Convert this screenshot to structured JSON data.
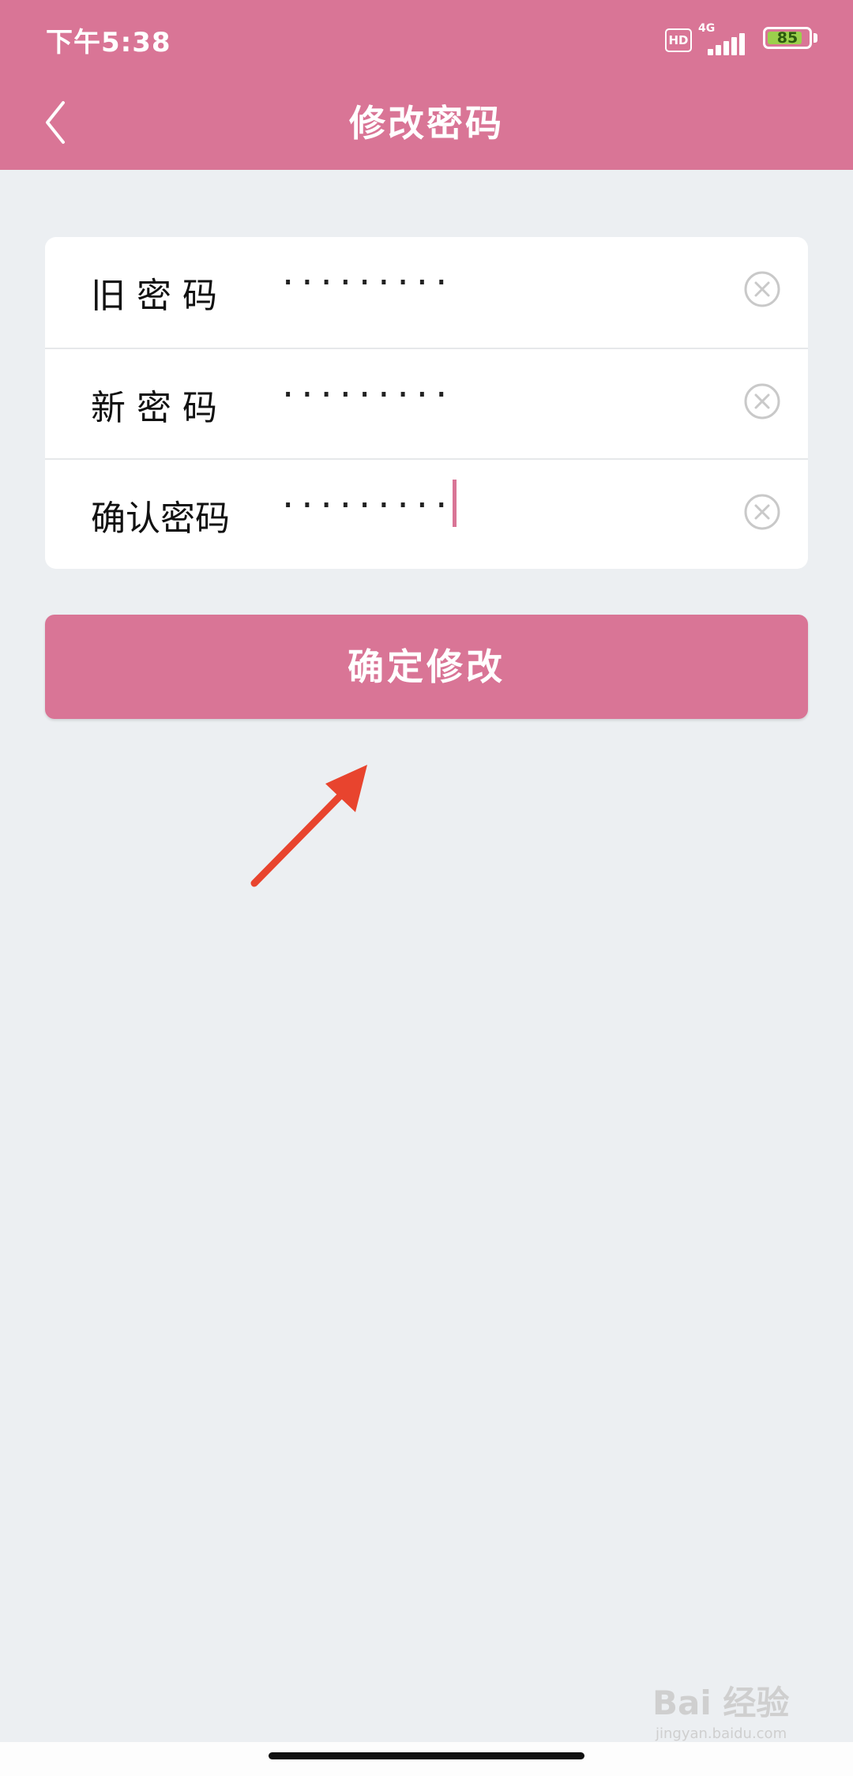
{
  "status_bar": {
    "time": "下午5:38",
    "hd_label": "HD",
    "network_label": "4G",
    "battery_percent": "85",
    "battery_level": 0.85
  },
  "header": {
    "title": "修改密码",
    "back_icon": "chevron-left-icon"
  },
  "form": {
    "fields": [
      {
        "label": "旧 密 码",
        "value": "·········",
        "clear_icon": "clear-circle-icon"
      },
      {
        "label": "新 密 码",
        "value": "·········",
        "clear_icon": "clear-circle-icon"
      },
      {
        "label": "确认密码",
        "value": "·········",
        "clear_icon": "clear-circle-icon"
      }
    ]
  },
  "submit_label": "确定修改",
  "annotation": {
    "arrow_color": "#e8442e"
  },
  "watermark": {
    "main": "Bai 经验",
    "sub": "jingyan.baidu.com"
  },
  "colors": {
    "accent": "#d97596",
    "background": "#eceff2",
    "card": "#ffffff"
  }
}
